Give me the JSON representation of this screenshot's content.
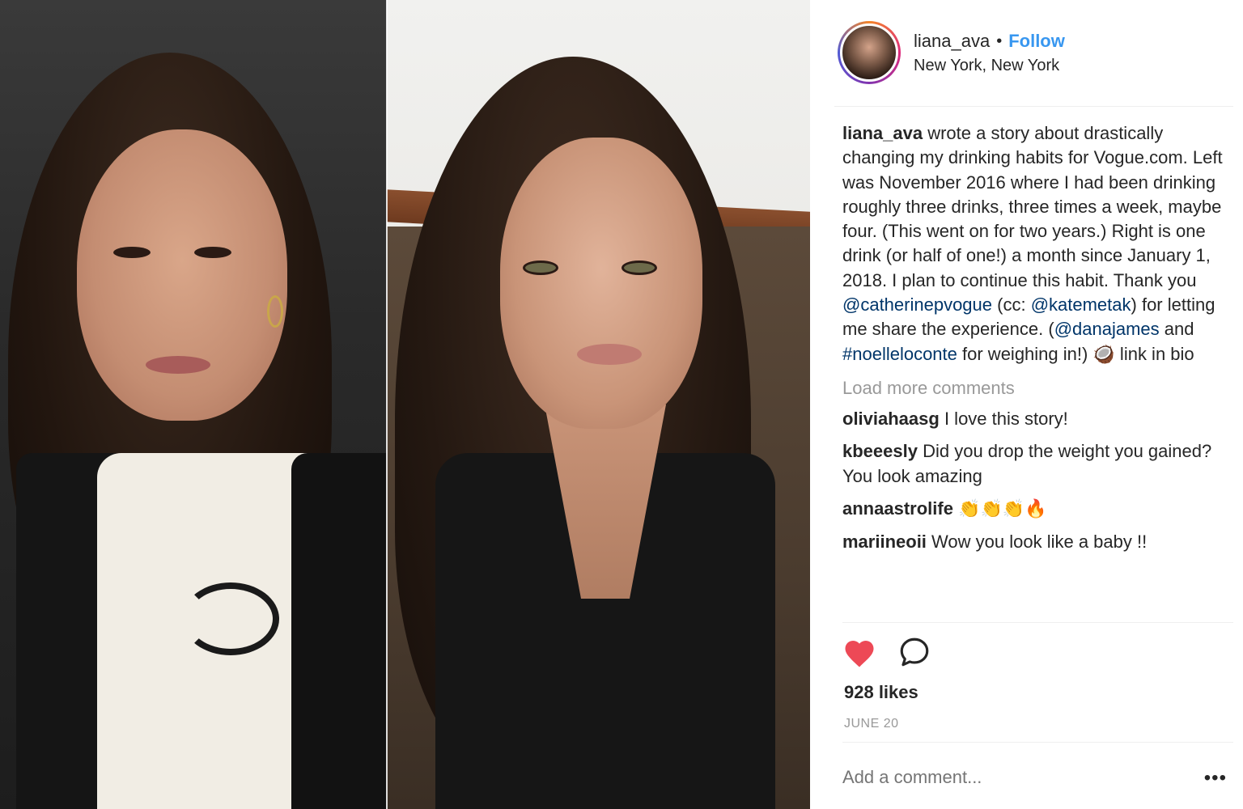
{
  "header": {
    "username": "liana_ava",
    "separator": "•",
    "follow_label": "Follow",
    "location": "New York, New York"
  },
  "caption": {
    "user": "liana_ava",
    "text_1": " wrote a story about drastically changing my drinking habits for Vogue.com. Left was November 2016 where I had been drinking roughly three drinks, three times a week, maybe four. (This went on for two years.) Right is one drink (or half of one!) a month since January 1, 2018. I plan to continue this habit. Thank you ",
    "mention_1": "@catherinepvogue",
    "text_2": " (cc: ",
    "mention_2": "@katemetak",
    "text_3": ") for letting me share the experience. (",
    "mention_3": "@danajames",
    "text_4": " and ",
    "hashtag_1": "#noelleloconte",
    "text_5": " for weighing in!) 🥥 link in bio"
  },
  "load_more_label": "Load more comments",
  "comments": [
    {
      "user": "oliviahaasg",
      "text": " I love this story!"
    },
    {
      "user": "kbeeesly",
      "text": " Did you drop the weight you gained? You look amazing"
    },
    {
      "user": "annaastrolife",
      "text": " 👏👏👏🔥"
    },
    {
      "user": "mariineoii",
      "text": " Wow you look like a baby !!"
    }
  ],
  "likes": "928 likes",
  "date": "JUNE 20",
  "add_comment_placeholder": "Add a comment...",
  "more_label": "•••",
  "colors": {
    "accent": "#3897f0",
    "mention": "#003569",
    "heart": "#ed4956",
    "muted": "#999999"
  },
  "icons": {
    "like": "heart-icon",
    "comment": "comment-bubble-icon",
    "more": "more-options-icon"
  }
}
